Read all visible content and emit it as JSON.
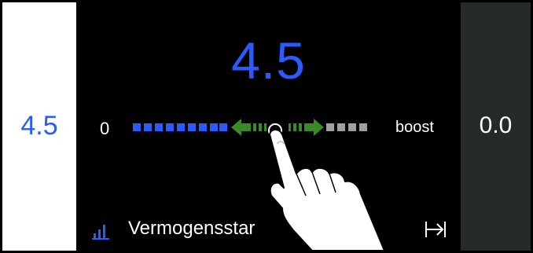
{
  "left_panel": {
    "value": "4.5"
  },
  "main": {
    "value": "4.5",
    "scale_min": "0",
    "scale_max": "boost",
    "bottom_label": "Vermogensstar"
  },
  "right_panel": {
    "value": "0.0"
  },
  "slider": {
    "level": 4.5,
    "max_level": 9
  },
  "colors": {
    "accent": "#2a5bff",
    "inactive_segment": "#a0a0a0",
    "arrow": "#3a8a2a",
    "right_panel_bg": "#252b2b"
  },
  "icons": {
    "bottom": "power-level-icon",
    "end": "tab-right-arrow-icon",
    "drag": "drag-arrows-icon"
  }
}
